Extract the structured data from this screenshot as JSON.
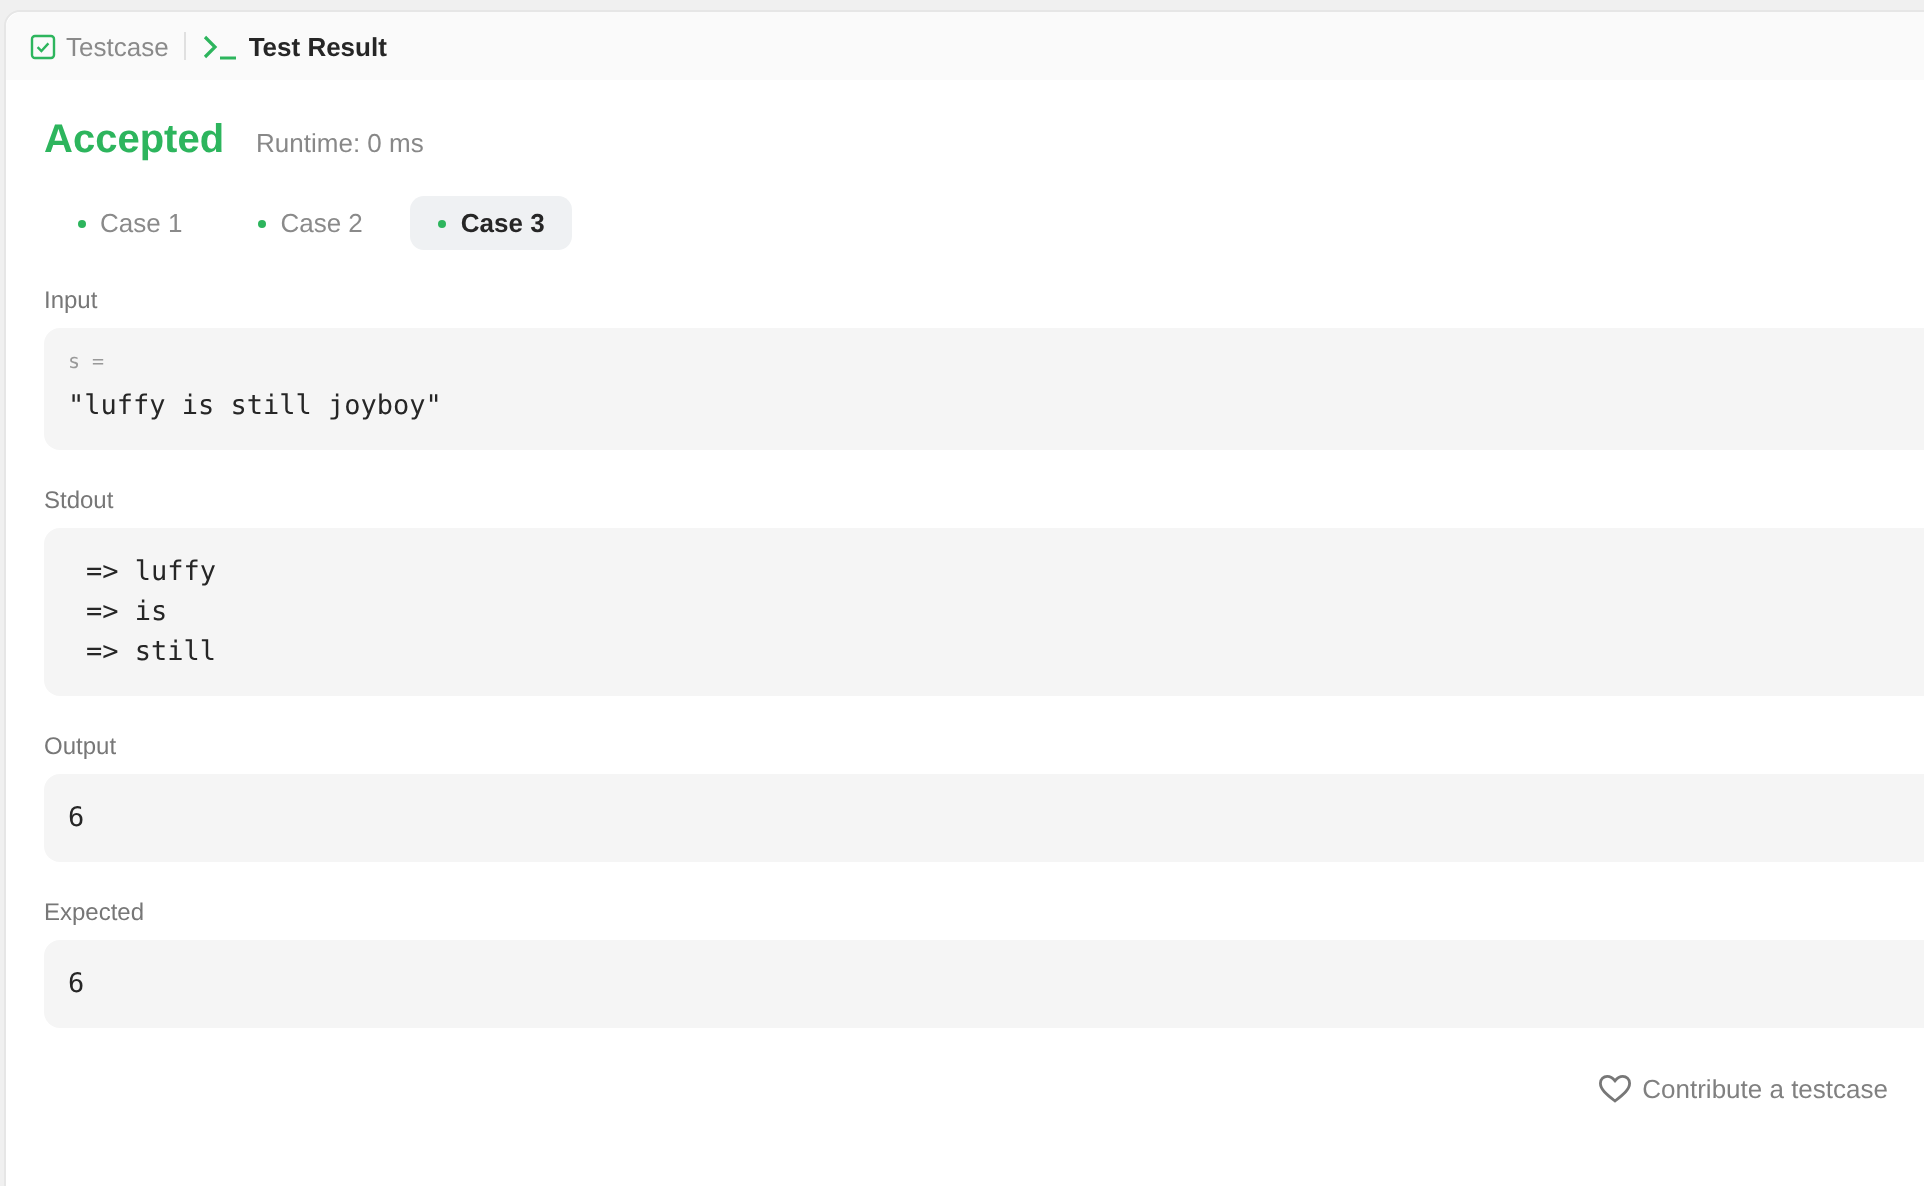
{
  "tabs": [
    {
      "label": "Testcase",
      "kind": "checklist",
      "selected": false
    },
    {
      "label": "Test Result",
      "kind": "console",
      "selected": true
    }
  ],
  "result": {
    "status": "Accepted",
    "runtime": "Runtime: 0 ms"
  },
  "cases": [
    {
      "label": "Case 1",
      "selected": false
    },
    {
      "label": "Case 2",
      "selected": false
    },
    {
      "label": "Case 3",
      "selected": true
    }
  ],
  "sections": [
    {
      "kind": "input",
      "label": "Input",
      "variable": "s =",
      "value": "\"luffy is still joyboy\""
    },
    {
      "kind": "lines",
      "label": "Stdout",
      "lines": [
        "=> luffy",
        "=> is",
        "=> still"
      ]
    },
    {
      "kind": "value",
      "label": "Output",
      "value": "6"
    },
    {
      "kind": "value",
      "label": "Expected",
      "value": "6"
    }
  ],
  "contribute_link": "Contribute a testcase"
}
